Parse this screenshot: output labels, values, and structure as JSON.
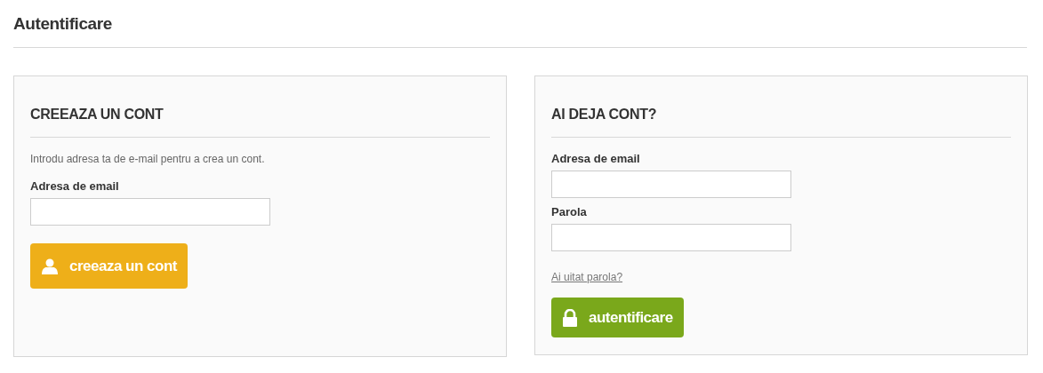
{
  "page_title": "Autentificare",
  "panels": [
    {
      "title": "CREEAZA UN CONT",
      "intro": "Introdu adresa ta de e-mail pentru a crea un cont.",
      "fields": [
        {
          "label": "Adresa de email"
        }
      ],
      "button": {
        "label": "creeaza un cont",
        "kind": "register"
      }
    },
    {
      "title": "AI DEJA CONT?",
      "fields": [
        {
          "label": "Adresa de email"
        },
        {
          "label": "Parola"
        }
      ],
      "link": "Ai uitat parola?",
      "button": {
        "label": "autentificare",
        "kind": "login"
      }
    }
  ]
}
